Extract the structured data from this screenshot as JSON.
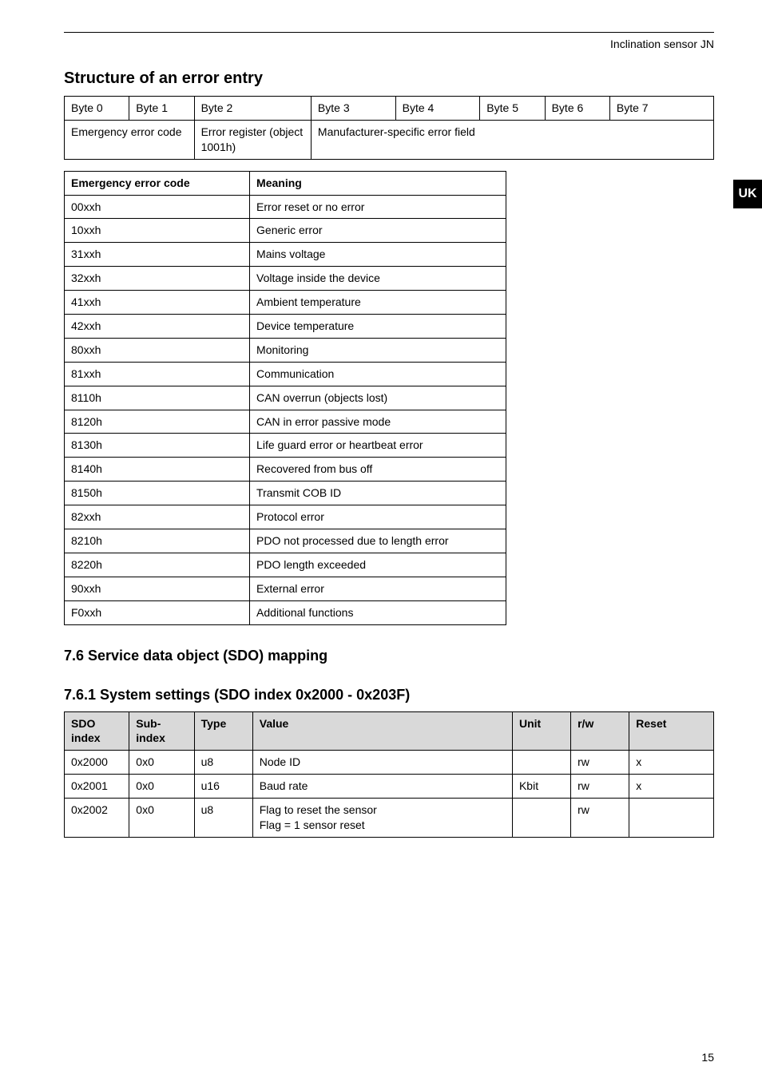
{
  "running_header": "Inclination sensor JN",
  "side_tab": "UK",
  "page_number": "15",
  "section1_heading": "Structure of an error entry",
  "table_error_entry": {
    "row1": {
      "c0": "Byte 0",
      "c1": "Byte 1",
      "c2": "Byte 2",
      "c3": "Byte 3",
      "c4": "Byte 4",
      "c5": "Byte 5",
      "c6": "Byte 6",
      "c7": "Byte 7"
    },
    "row2": {
      "c0": "Emergency error code",
      "c1": "Error register (object 1001h)",
      "c2": "Manufacturer-specific error field"
    }
  },
  "table_codes": {
    "header": {
      "c0": "Emergency error code",
      "c1": "Meaning"
    },
    "rows": [
      {
        "c0": "00xxh",
        "c1": "Error reset or no error"
      },
      {
        "c0": "10xxh",
        "c1": "Generic error"
      },
      {
        "c0": "31xxh",
        "c1": "Mains voltage"
      },
      {
        "c0": "32xxh",
        "c1": "Voltage inside the device"
      },
      {
        "c0": "41xxh",
        "c1": "Ambient temperature"
      },
      {
        "c0": "42xxh",
        "c1": "Device temperature"
      },
      {
        "c0": "80xxh",
        "c1": "Monitoring"
      },
      {
        "c0": "81xxh",
        "c1": "Communication"
      },
      {
        "c0": "8110h",
        "c1": "CAN overrun (objects lost)"
      },
      {
        "c0": "8120h",
        "c1": "CAN in error passive mode"
      },
      {
        "c0": "8130h",
        "c1": "Life guard error or heartbeat error"
      },
      {
        "c0": "8140h",
        "c1": "Recovered from bus off"
      },
      {
        "c0": "8150h",
        "c1": "Transmit COB ID"
      },
      {
        "c0": "82xxh",
        "c1": "Protocol error"
      },
      {
        "c0": "8210h",
        "c1": "PDO not processed due to length error"
      },
      {
        "c0": "8220h",
        "c1": "PDO length exceeded"
      },
      {
        "c0": "90xxh",
        "c1": "External error"
      },
      {
        "c0": "F0xxh",
        "c1": "Additional functions"
      }
    ]
  },
  "section76_heading": "7.6  Service data object (SDO) mapping",
  "section761_heading": "7.6.1  System settings (SDO index 0x2000 - 0x203F)",
  "table_sdo": {
    "header": {
      "c0": "SDO index",
      "c1": "Sub-index",
      "c2": "Type",
      "c3": "Value",
      "c4": "Unit",
      "c5": "r/w",
      "c6": "Reset"
    },
    "rows": [
      {
        "c0": "0x2000",
        "c1": "0x0",
        "c2": "u8",
        "c3": "Node ID",
        "c4": "",
        "c5": "rw",
        "c6": "x"
      },
      {
        "c0": "0x2001",
        "c1": "0x0",
        "c2": "u16",
        "c3": "Baud rate",
        "c4": "Kbit",
        "c5": "rw",
        "c6": "x"
      },
      {
        "c0": "0x2002",
        "c1": "0x0",
        "c2": "u8",
        "c3": "Flag to reset the sensor\nFlag = 1 sensor reset",
        "c4": "",
        "c5": "rw",
        "c6": ""
      }
    ]
  }
}
